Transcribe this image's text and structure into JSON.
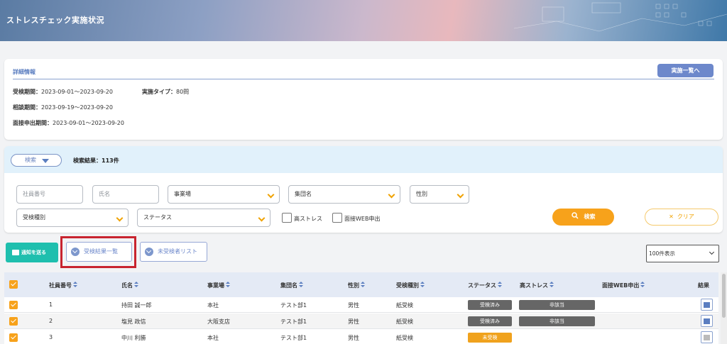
{
  "header": {
    "title": "ストレスチェック実施状況"
  },
  "detail": {
    "heading": "詳細情報",
    "list_button": "実施一覧へ",
    "period_label": "受検期間：",
    "period_value": "2023-09-01～2023-09-20",
    "type_label": "実施タイプ：",
    "type_value": "80問",
    "consult_label": "相談期間：",
    "consult_value": "2023-09-19～2023-09-20",
    "interview_label": "面接申出期間：",
    "interview_value": "2023-09-01～2023-09-20"
  },
  "search": {
    "toggle_label": "検索",
    "result_count": "検索結果：113件",
    "employee_no_placeholder": "社員番号",
    "name_placeholder": "氏名",
    "office_select": "事業場",
    "group_select": "集団名",
    "gender_select": "性別",
    "exam_type_select": "受検種別",
    "status_select": "ステータス",
    "high_stress_label": "高ストレス",
    "web_interview_label": "面接WEB申出",
    "search_button": "検索",
    "clear_button": "クリア"
  },
  "actions": {
    "notify_button": "通知を送る",
    "results_list_button": "受検結果一覧",
    "unexamined_list_button": "未受検者リスト",
    "per_page": "100件表示"
  },
  "table": {
    "headers": {
      "employee_no": "社員番号",
      "name": "氏名",
      "office": "事業場",
      "group": "集団名",
      "gender": "性別",
      "exam_type": "受検種別",
      "status": "ステータス",
      "high_stress": "高ストレス",
      "web_interview": "面接WEB申出",
      "result": "結果"
    },
    "rows": [
      {
        "no": "1",
        "name": "持田 誠一郎",
        "office": "本社",
        "group": "テスト部1",
        "gender": "男性",
        "exam_type": "紙受検",
        "status": "受検済み",
        "high_stress": "非該当"
      },
      {
        "no": "2",
        "name": "塩見 政信",
        "office": "大阪支店",
        "group": "テスト部1",
        "gender": "男性",
        "exam_type": "紙受検",
        "status": "受検済み",
        "high_stress": "非該当"
      },
      {
        "no": "3",
        "name": "中川 利勝",
        "office": "本社",
        "group": "テスト部1",
        "gender": "男性",
        "exam_type": "紙受検",
        "status": "未受検",
        "high_stress": ""
      }
    ]
  },
  "colors": {
    "accent": "#5b7ec0",
    "orange": "#f7a21b",
    "teal": "#1fbfae",
    "highlight": "#c8242f"
  },
  "icons": [
    "mail-icon",
    "download-icon",
    "search-icon",
    "close-icon",
    "chevron-down-icon",
    "sort-icon",
    "bar-chart-icon"
  ]
}
